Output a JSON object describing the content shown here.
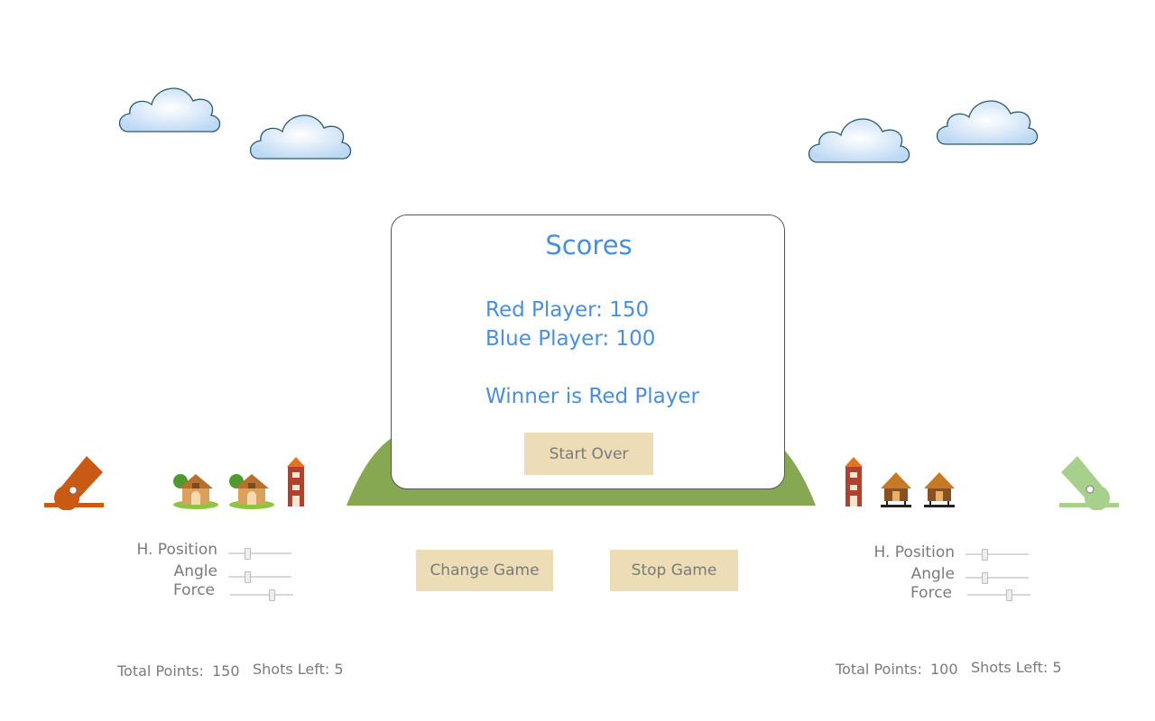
{
  "modal": {
    "title": "Scores",
    "red_score": "Red Player: 150",
    "blue_score": "Blue Player: 100",
    "winner": "Winner is Red Player",
    "start_over_label": "Start Over"
  },
  "controls": {
    "left": {
      "h_position_label": "H. Position",
      "angle_label": "Angle",
      "force_label": "Force",
      "h_position_value": 0.3,
      "angle_value": 0.3,
      "force_value": 0.65
    },
    "right": {
      "h_position_label": "H. Position",
      "angle_label": "Angle",
      "force_label": "Force",
      "h_position_value": 0.3,
      "angle_value": 0.3,
      "force_value": 0.65
    }
  },
  "buttons": {
    "change_game_label": "Change Game",
    "stop_game_label": "Stop Game"
  },
  "footer": {
    "left": {
      "total_points_label": "Total Points:",
      "total_points_value": "150",
      "shots_left": "Shots Left: 5"
    },
    "right": {
      "total_points_label": "Total Points:",
      "total_points_value": "100",
      "shots_left": "Shots Left: 5"
    }
  },
  "colors": {
    "red_cannon": "#c85a14",
    "blue_cannon": "#a8d08d",
    "hill": "#86a852",
    "score_text": "#4a8fdc",
    "button_bg": "#ecddb6"
  },
  "icons": {
    "left_cannon": "red-cannon-icon",
    "right_cannon": "green-cannon-icon",
    "cloud": "cloud-icon",
    "house": "cottage-icon",
    "tower": "tower-icon",
    "hut": "hut-icon"
  }
}
